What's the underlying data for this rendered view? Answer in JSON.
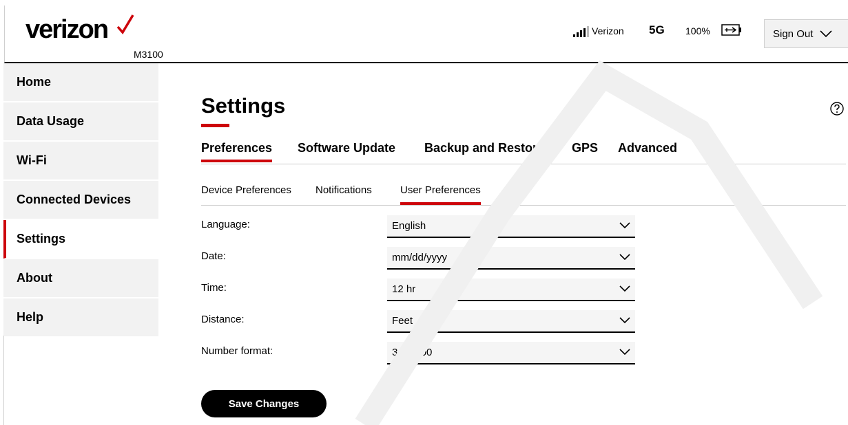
{
  "header": {
    "brand": "verizon",
    "model": "M3100",
    "carrier": "Verizon",
    "network": "5G",
    "battery": "100%",
    "signout_label": "Sign Out"
  },
  "sidebar": {
    "items": [
      {
        "label": "Home"
      },
      {
        "label": "Data Usage"
      },
      {
        "label": "Wi-Fi"
      },
      {
        "label": "Connected Devices"
      },
      {
        "label": "Settings"
      },
      {
        "label": "About"
      },
      {
        "label": "Help"
      }
    ],
    "active": "Settings"
  },
  "main": {
    "title": "Settings",
    "tabs": [
      {
        "label": "Preferences"
      },
      {
        "label": "Software Update"
      },
      {
        "label": "Backup and Restore"
      },
      {
        "label": "GPS"
      },
      {
        "label": "Advanced"
      }
    ],
    "subtabs": [
      {
        "label": "Device Preferences"
      },
      {
        "label": "Notifications"
      },
      {
        "label": "User Preferences"
      }
    ],
    "form": {
      "language": {
        "label": "Language:",
        "value": "English"
      },
      "date": {
        "label": "Date:",
        "value": "mm/dd/yyyy"
      },
      "time": {
        "label": "Time:",
        "value": "12 hr"
      },
      "distance": {
        "label": "Distance:",
        "value": "Feet"
      },
      "number_format": {
        "label": "Number format:",
        "value": "3,234.00"
      }
    },
    "save_label": "Save Changes"
  },
  "colors": {
    "accent": "#cd040b",
    "sidebar_bg": "#f2f2f2",
    "button_bg": "#000000"
  },
  "icons": {
    "logo_check": "check-mark-icon",
    "signal": "signal-bars-icon",
    "battery": "battery-charging-icon",
    "chevron": "chevron-down-icon",
    "help": "help-circle-icon"
  }
}
